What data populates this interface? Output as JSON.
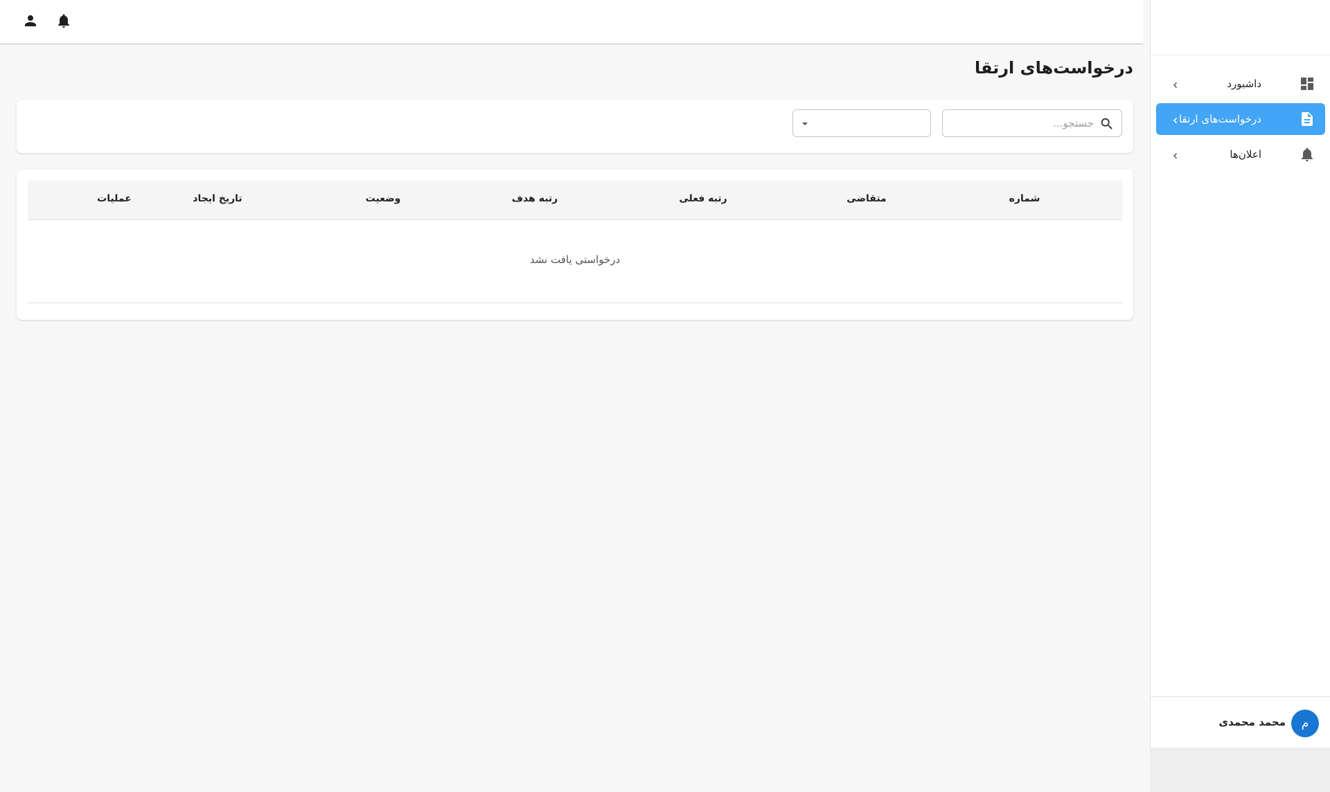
{
  "header": {
    "notifications_icon": "bell-icon",
    "account_icon": "person-icon"
  },
  "sidebar": {
    "items": [
      {
        "label": "داشبورد",
        "icon": "dashboard-icon",
        "active": false
      },
      {
        "label": "درخواست‌های ارتقا",
        "icon": "document-icon",
        "active": true
      },
      {
        "label": "اعلان‌ها",
        "icon": "bell-icon",
        "active": false
      }
    ],
    "user": {
      "avatar_letter": "م",
      "name": "محمد محمدی"
    }
  },
  "page": {
    "title": "درخواست‌های ارتقا"
  },
  "filters": {
    "search_placeholder": "جستجو...",
    "status_select_value": ""
  },
  "table": {
    "columns": [
      "شماره",
      "متقاضی",
      "رتبه فعلی",
      "رتبه هدف",
      "وضعیت",
      "تاریخ ایجاد",
      "عملیات"
    ],
    "empty_message": "درخواستی یافت نشد"
  },
  "colors": {
    "accent": "#42a5f5",
    "avatar": "#1976d2",
    "background": "#f7f7f7"
  }
}
